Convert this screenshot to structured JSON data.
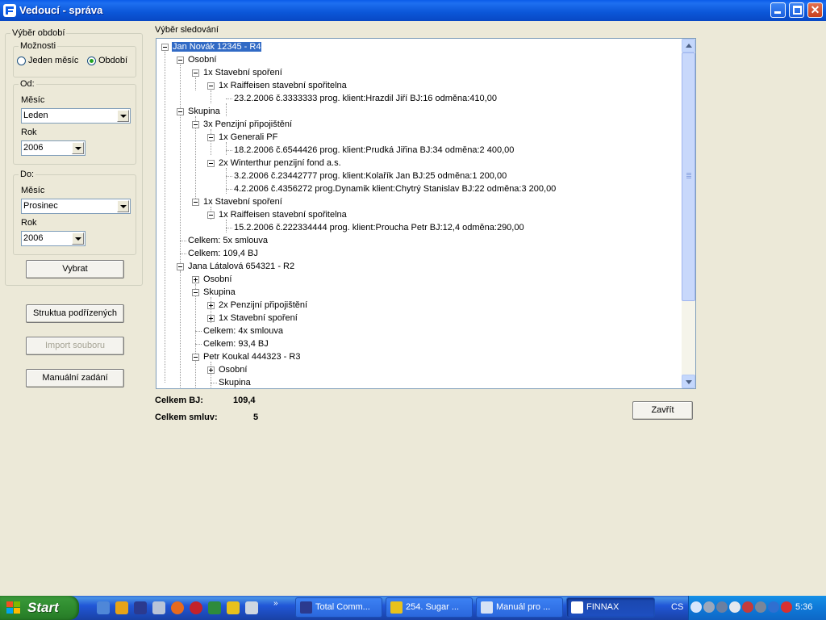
{
  "window": {
    "title": "Vedoucí - správa"
  },
  "period": {
    "legend": "Výběr období",
    "options_legend": "Možnosti",
    "option_month": "Jeden měsíc",
    "option_range": "Období",
    "selected": "Období",
    "from": {
      "legend": "Od:",
      "month_label": "Měsíc",
      "month_value": "Leden",
      "year_label": "Rok",
      "year_value": "2006"
    },
    "to": {
      "legend": "Do:",
      "month_label": "Měsíc",
      "month_value": "Prosinec",
      "year_label": "Rok",
      "year_value": "2006"
    },
    "select_button": "Vybrat"
  },
  "sidebar_buttons": {
    "structure": "Struktua podřízených",
    "import": "Import souboru",
    "manual": "Manuální zadání"
  },
  "tree": {
    "label": "Výběr sledování",
    "nodes": [
      "Jan Novák  12345 - R4",
      "Osobní",
      "1x Stavební spoření",
      "1x Raiffeisen stavební spořitelna",
      "23.2.2006  č.3333333  prog.  klient:Hrazdil Jiří  BJ:16  odměna:410,00",
      "Skupina",
      "3x Penzijní připojištění",
      "1x Generali PF",
      "18.2.2006  č.6544426  prog.  klient:Prudká Jiřina  BJ:34  odměna:2 400,00",
      "2x Winterthur penzijní fond a.s.",
      "3.2.2006  č.23442777  prog.  klient:Kolařík Jan  BJ:25  odměna:1 200,00",
      "4.2.2006  č.4356272  prog.Dynamik  klient:Chytrý Stanislav  BJ:22  odměna:3 200,00",
      "1x Stavební spoření",
      "1x Raiffeisen stavební spořitelna",
      "15.2.2006  č.222334444  prog.  klient:Proucha Petr  BJ:12,4  odměna:290,00",
      "Celkem: 5x smlouva",
      "Celkem: 109,4 BJ",
      "Jana Látalová  654321 - R2",
      "Osobní",
      "Skupina",
      "2x Penzijní připojištění",
      "1x Stavební spoření",
      "Celkem: 4x smlouva",
      "Celkem: 93,4 BJ",
      "Petr Koukal  444323 - R3",
      "Osobní",
      "Skupina"
    ]
  },
  "totals": {
    "bj_label": "Celkem BJ:",
    "bj_value": "109,4",
    "contracts_label": "Celkem smluv:",
    "contracts_value": "5"
  },
  "close_button": "Zavřít",
  "taskbar": {
    "start": "Start",
    "tasks": [
      "Total Comm...",
      "254. Sugar ...",
      "Manuál pro ...",
      "FINNAX"
    ],
    "lang": "CS",
    "clock": "5:36"
  }
}
